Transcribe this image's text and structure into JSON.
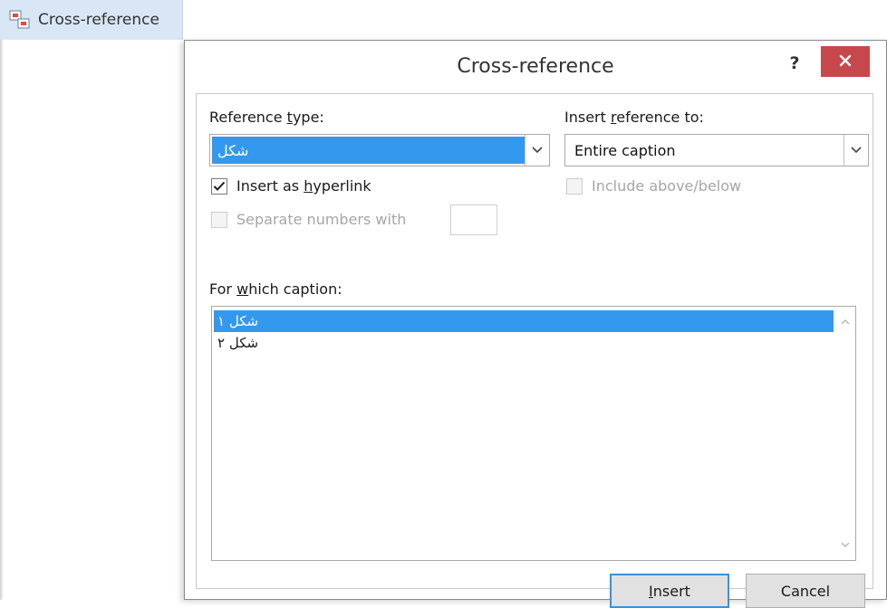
{
  "ribbon": {
    "button_label": "Cross-reference",
    "icon": "cross-reference-icon"
  },
  "dialog": {
    "title": "Cross-reference",
    "help_label": "?",
    "close_icon": "close-icon",
    "close_color": "#c7484c"
  },
  "reference_type": {
    "label_pre": "Reference ",
    "label_accel": "t",
    "label_post": "ype:",
    "value": "شكل",
    "dropdown_icon": "chevron-down-icon"
  },
  "insert_reference_to": {
    "label_pre": "Insert ",
    "label_accel": "r",
    "label_post": "eference to:",
    "value": "Entire caption",
    "dropdown_icon": "chevron-down-icon"
  },
  "insert_as_hyperlink": {
    "label_pre": "Insert as ",
    "label_accel": "h",
    "label_post": "yperlink",
    "checked": true
  },
  "include_above_below": {
    "label": "Include above/below",
    "checked": false,
    "enabled": false
  },
  "separate_numbers": {
    "label": "Separate numbers with",
    "checked": false,
    "enabled": false,
    "value": ""
  },
  "for_which_caption": {
    "label_pre": "For ",
    "label_accel": "w",
    "label_post": "hich caption:",
    "items": [
      {
        "text": "شکل ۱",
        "selected": true
      },
      {
        "text": "شکل ۲",
        "selected": false
      }
    ]
  },
  "buttons": {
    "insert_accel": "I",
    "insert_rest": "nsert",
    "cancel_label": "Cancel"
  },
  "colors": {
    "selection": "#3399ee",
    "default_button_border": "#3c8fdb",
    "ribbon_highlight": "#d8e6f5"
  }
}
